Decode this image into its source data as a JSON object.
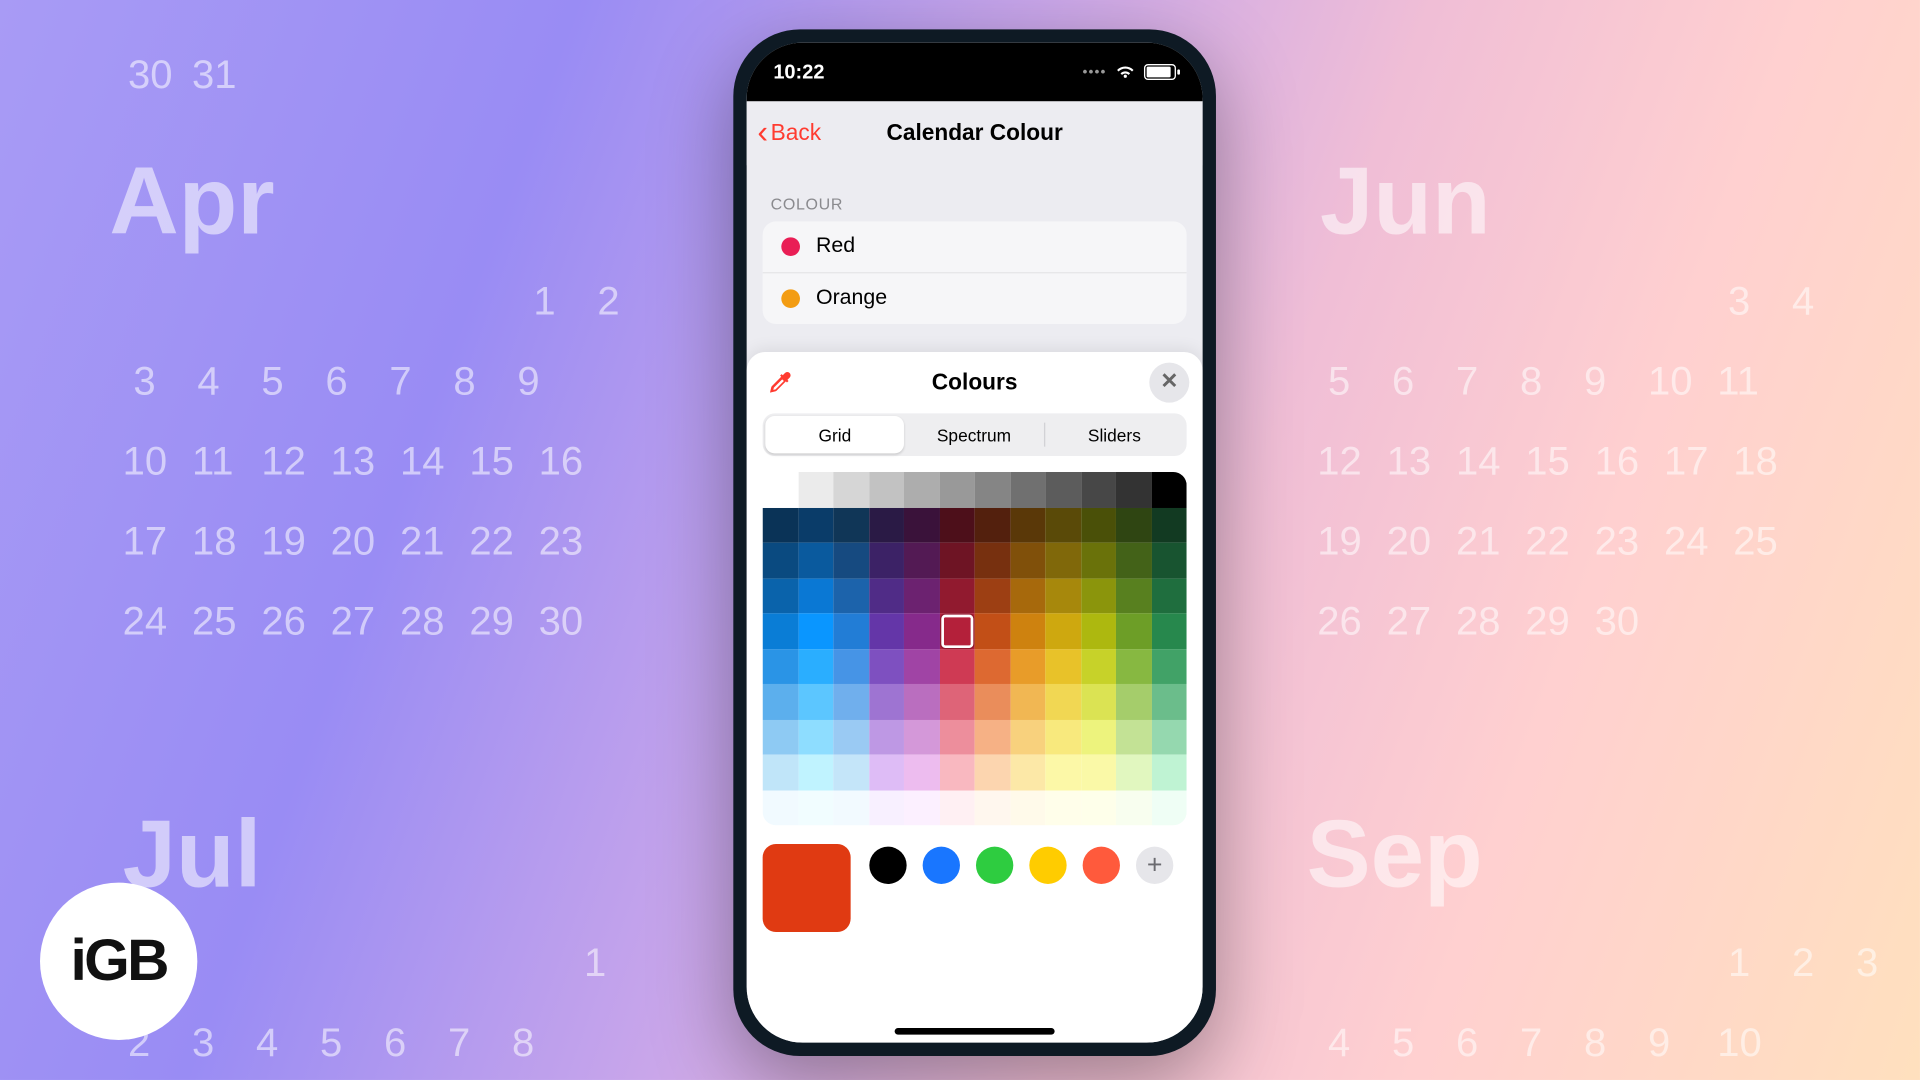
{
  "logo": "iGB",
  "status": {
    "time": "10:22"
  },
  "nav": {
    "back": "Back",
    "title": "Calendar Colour"
  },
  "section_header": "COLOUR",
  "color_rows": [
    {
      "name": "Red",
      "swatch": "#e91e55"
    },
    {
      "name": "Orange",
      "swatch": "#f39c12"
    }
  ],
  "sheet": {
    "title": "Colours",
    "tabs": {
      "grid": "Grid",
      "spectrum": "Spectrum",
      "sliders": "Sliders"
    },
    "selected": {
      "row": 4,
      "col": 5,
      "color": "#e03a12"
    },
    "preset_chips": [
      "#000000",
      "#1976ff",
      "#2ecc40",
      "#ffcc00",
      "#ff5a3c"
    ]
  },
  "grid_colors": [
    [
      "#ffffff",
      "#ebebeb",
      "#d6d6d6",
      "#c2c2c2",
      "#adadad",
      "#999999",
      "#858585",
      "#707070",
      "#5c5c5c",
      "#474747",
      "#333333",
      "#000000"
    ],
    [
      "#0a3357",
      "#0a3c69",
      "#103657",
      "#2a1a45",
      "#3a123a",
      "#4d0f1a",
      "#53200d",
      "#5a3808",
      "#5a4a08",
      "#4a5008",
      "#2f4512",
      "#123a22"
    ],
    [
      "#0a4a80",
      "#0a5a9e",
      "#164a80",
      "#3c2266",
      "#531a54",
      "#6e1424",
      "#77300f",
      "#80500a",
      "#80680a",
      "#6a720a",
      "#436218",
      "#185430"
    ],
    [
      "#0a63ab",
      "#0a78d4",
      "#1c63ab",
      "#502c87",
      "#6c2270",
      "#911a2f",
      "#9d3f13",
      "#a7690c",
      "#a7880c",
      "#8b950c",
      "#58801f",
      "#1f6e3e"
    ],
    [
      "#0a7dd6",
      "#0a96ff",
      "#227dd6",
      "#6436a8",
      "#862a8b",
      "#b4203a",
      "#c24f17",
      "#ce820f",
      "#cea80f",
      "#adb80f",
      "#6d9e27",
      "#27884d"
    ],
    [
      "#2a94e6",
      "#2aaeff",
      "#4694e6",
      "#7e50c0",
      "#a044a5",
      "#cf3a54",
      "#dd6931",
      "#e89c29",
      "#e8c229",
      "#c7d229",
      "#87b841",
      "#41a267"
    ],
    [
      "#5cafed",
      "#5cc6ff",
      "#70afed",
      "#9e74d2",
      "#ba6ebf",
      "#de6478",
      "#ea8d5b",
      "#f1b753",
      "#f1d753",
      "#dbe353",
      "#a5cd6b",
      "#6bbd8b"
    ],
    [
      "#8ecaf3",
      "#8eddff",
      "#9acaf3",
      "#be98e4",
      "#d498d9",
      "#ed8e9c",
      "#f6b185",
      "#f8d17d",
      "#f8e97d",
      "#edf37d",
      "#c3e295",
      "#95d8af"
    ],
    [
      "#c0e5f9",
      "#c0f3ff",
      "#c4e5f9",
      "#debcf6",
      "#edbcef",
      "#f9b8c0",
      "#fcd5af",
      "#fce8a7",
      "#fcf8a7",
      "#faf9a7",
      "#e1f7bf",
      "#bff3d3"
    ],
    [
      "#f1faff",
      "#f1fdff",
      "#f2faff",
      "#f8f0ff",
      "#fcf0ff",
      "#fff0f3",
      "#fff7ee",
      "#fffaea",
      "#fffeea",
      "#feffea",
      "#f8feef",
      "#effef5"
    ]
  ],
  "bg_months": {
    "apr": "Apr",
    "jun": "Jun",
    "jul": "Jul",
    "sep": "Sep"
  }
}
